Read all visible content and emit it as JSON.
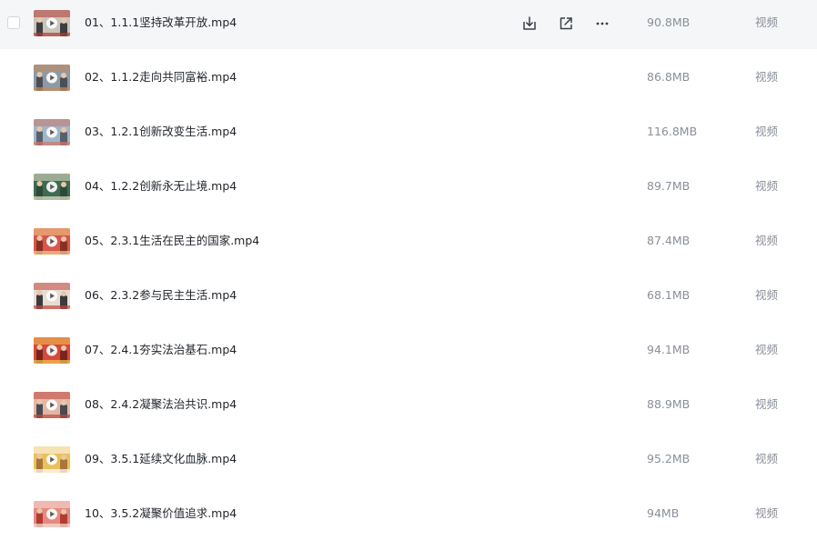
{
  "colors": {
    "row_hover_bg": "#f5f6f8",
    "name_text": "#1f2329",
    "meta_text": "#8a8f99",
    "icon_stroke": "#3a3f47"
  },
  "hover_actions": [
    {
      "icon": "download-icon"
    },
    {
      "icon": "share-icon"
    },
    {
      "icon": "more-icon"
    }
  ],
  "files": [
    {
      "name": "01、1.1.1坚持改革开放.mp4",
      "size": "90.8MB",
      "type": "视频",
      "hovered": true,
      "thumb": {
        "bg": "#c9c4bc",
        "accent": "#b33a2f",
        "figure": "#3d3f44"
      }
    },
    {
      "name": "02、1.1.2走向共同富裕.mp4",
      "size": "86.8MB",
      "type": "视频",
      "hovered": false,
      "thumb": {
        "bg": "#8d9aa6",
        "accent": "#c98a57",
        "figure": "#4b4e57"
      }
    },
    {
      "name": "03、1.2.1创新改变生活.mp4",
      "size": "116.8MB",
      "type": "视频",
      "hovered": false,
      "thumb": {
        "bg": "#9fb6c7",
        "accent": "#d0776b",
        "figure": "#58606a"
      }
    },
    {
      "name": "04、1.2.2创新永无止境.mp4",
      "size": "89.7MB",
      "type": "视频",
      "hovered": false,
      "thumb": {
        "bg": "#3e6b52",
        "accent": "#e9e1c8",
        "figure": "#2c4a3a"
      }
    },
    {
      "name": "05、2.3.1生活在民主的国家.mp4",
      "size": "87.4MB",
      "type": "视频",
      "hovered": false,
      "thumb": {
        "bg": "#d8564a",
        "accent": "#f1d08a",
        "figure": "#8a2f27"
      }
    },
    {
      "name": "06、2.3.2参与民主生活.mp4",
      "size": "68.1MB",
      "type": "视频",
      "hovered": false,
      "thumb": {
        "bg": "#e7ddd2",
        "accent": "#c2463d",
        "figure": "#3a3a40"
      }
    },
    {
      "name": "07、2.4.1夯实法治基石.mp4",
      "size": "94.1MB",
      "type": "视频",
      "hovered": false,
      "thumb": {
        "bg": "#d6493d",
        "accent": "#f2c94c",
        "figure": "#7a231c"
      }
    },
    {
      "name": "08、2.4.2凝聚法治共识.mp4",
      "size": "88.9MB",
      "type": "视频",
      "hovered": false,
      "thumb": {
        "bg": "#e2b7a8",
        "accent": "#c0483c",
        "figure": "#4a4a52"
      }
    },
    {
      "name": "09、3.5.1延续文化血脉.mp4",
      "size": "95.2MB",
      "type": "视频",
      "hovered": false,
      "thumb": {
        "bg": "#e8c15a",
        "accent": "#ffffff",
        "figure": "#a9753a"
      }
    },
    {
      "name": "10、3.5.2凝聚价值追求.mp4",
      "size": "94MB",
      "type": "视频",
      "hovered": false,
      "thumb": {
        "bg": "#e58a80",
        "accent": "#f6e2d8",
        "figure": "#b23b33"
      }
    }
  ]
}
